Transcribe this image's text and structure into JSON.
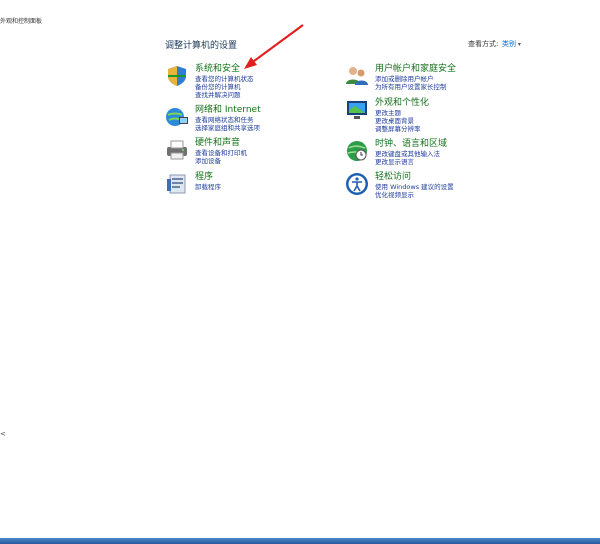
{
  "breadcrumb": "外观和控制面板",
  "header": {
    "title": "调整计算机的设置",
    "view_label": "查看方式:",
    "view_value": "类别"
  },
  "categories": [
    {
      "title": "系统和安全",
      "links": [
        "查看您的计算机状态",
        "备份您的计算机",
        "查找并解决问题"
      ]
    },
    {
      "title": "网络和 Internet",
      "links": [
        "查看网络状态和任务",
        "选择家庭组和共享选项"
      ]
    },
    {
      "title": "硬件和声音",
      "links": [
        "查看设备和打印机",
        "添加设备"
      ]
    },
    {
      "title": "程序",
      "links": [
        "卸载程序"
      ]
    },
    {
      "title": "用户帐户和家庭安全",
      "links": [
        "添加或删除用户帐户",
        "为所有用户设置家长控制"
      ]
    },
    {
      "title": "外观和个性化",
      "links": [
        "更改主题",
        "更改桌面背景",
        "调整屏幕分辨率"
      ]
    },
    {
      "title": "时钟、语言和区域",
      "links": [
        "更改键盘或其他输入法",
        "更改显示语言"
      ]
    },
    {
      "title": "轻松访问",
      "links": [
        "使用 Windows 建议的设置",
        "优化视频显示"
      ]
    }
  ],
  "icons": [
    "shield-icon",
    "network-icon",
    "printer-icon",
    "programs-icon",
    "users-icon",
    "display-icon",
    "globe-clock-icon",
    "accessibility-icon"
  ],
  "colors": {
    "title_green": "#15701b",
    "link_blue": "#1e3c9a",
    "arrow_red": "#e0201e"
  },
  "left_mark": "<"
}
